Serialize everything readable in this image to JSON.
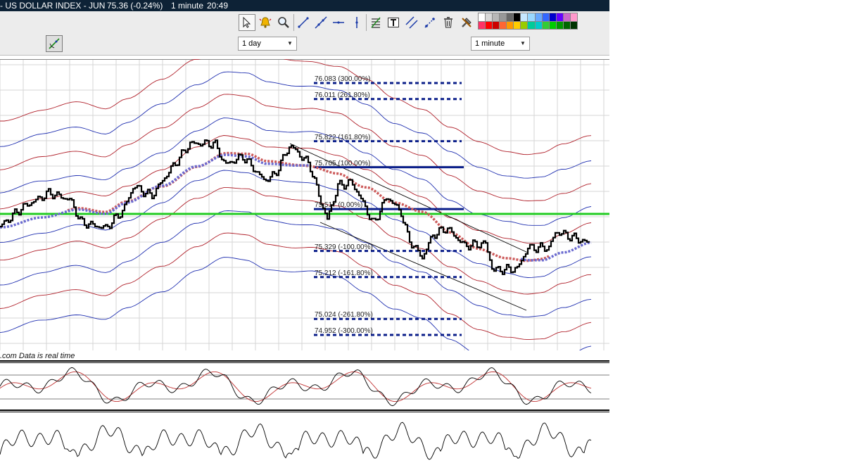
{
  "titlebar": {
    "instrument": "- US DOLLAR INDEX - JUN",
    "quote": "75.36 (-0.24%)",
    "interval": "1 minute",
    "time": "20:49"
  },
  "toolbar": {
    "tools": [
      "cursor-icon",
      "alert-bell-icon",
      "zoom-icon",
      "line-segment-icon",
      "trend-line-icon",
      "horizontal-line-icon",
      "vertical-line-icon",
      "fibonacci-icon",
      "text-icon",
      "parallel-channel-icon",
      "projection-icon",
      "delete-icon",
      "settings-tools-icon"
    ],
    "palette": [
      "#ffffff",
      "#d8d8d8",
      "#b8b8b8",
      "#989898",
      "#686868",
      "#000000",
      "#c8e8ff",
      "#99d8ff",
      "#66a8ff",
      "#3366ff",
      "#0000cc",
      "#6600ff",
      "#cc66cc",
      "#ff99cc",
      "#ff3366",
      "#ff0000",
      "#cc0000",
      "#ff6633",
      "#ff9900",
      "#ffcc00",
      "#99cc00",
      "#00cc99",
      "#00cccc",
      "#33cc33",
      "#00cc00",
      "#009900",
      "#006600",
      "#003300"
    ]
  },
  "controls": {
    "period": "1 day",
    "interval": "1 minute"
  },
  "status": ".com  Data is real time",
  "chart_data": {
    "type": "line",
    "fib_levels": [
      {
        "label": "76.083 (300.00%)",
        "value": 76.083
      },
      {
        "label": "76.011 (261.80%)",
        "value": 76.011
      },
      {
        "label": "75.822 (161.80%)",
        "value": 75.822
      },
      {
        "label": "75.705 (100.00%)",
        "value": 75.705
      },
      {
        "label": "75.517 (0.00%)",
        "value": 75.517
      },
      {
        "label": "75.329 (-100.00%)",
        "value": 75.329
      },
      {
        "label": "75.212 (-161.80%)",
        "value": 75.212
      },
      {
        "label": "75.024 (-261.80%)",
        "value": 75.024
      },
      {
        "label": "74.952 (-300.00%)",
        "value": 74.952
      }
    ],
    "horizontal_line": 75.505,
    "last_price": 75.36,
    "colors": {
      "price": "#000000",
      "upper_band": "#b0202a",
      "lower_band": "#1f2fb0",
      "ma_red": "#cc5a5a",
      "ma_blue": "#6a6ad0",
      "fib": "#0b1f8a",
      "hline": "#22cc22",
      "grid": "#d6d6d6"
    }
  }
}
